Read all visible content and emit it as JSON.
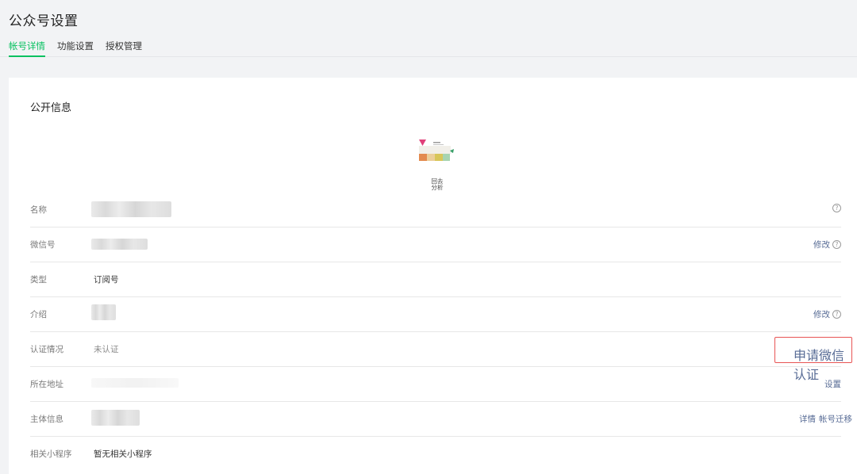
{
  "page": {
    "title": "公众号设置"
  },
  "tabs": [
    {
      "label": "帐号详情",
      "active": true
    },
    {
      "label": "功能设置",
      "active": false
    },
    {
      "label": "授权管理",
      "active": false
    }
  ],
  "section": {
    "title": "公开信息"
  },
  "avatar": {
    "qr_caption": "回去\n分析"
  },
  "rows": {
    "name": {
      "label": "名称",
      "help_icon": "?"
    },
    "wechat_id": {
      "label": "微信号",
      "action": "修改",
      "help_icon": "?"
    },
    "type": {
      "label": "类型",
      "value": "订阅号"
    },
    "intro": {
      "label": "介绍",
      "action": "修改",
      "help_icon": "?"
    },
    "verification": {
      "label": "认证情况",
      "value": "未认证",
      "action": "申请微信认证"
    },
    "address": {
      "label": "所在地址",
      "action": "设置"
    },
    "entity": {
      "label": "主体信息",
      "action_details": "详情",
      "action_migrate": "帐号迁移"
    },
    "mini_program": {
      "label": "相关小程序",
      "value": "暂无相关小程序"
    }
  },
  "colors": {
    "accent": "#07c160",
    "link": "#576b95",
    "highlight_border": "#e85454"
  }
}
